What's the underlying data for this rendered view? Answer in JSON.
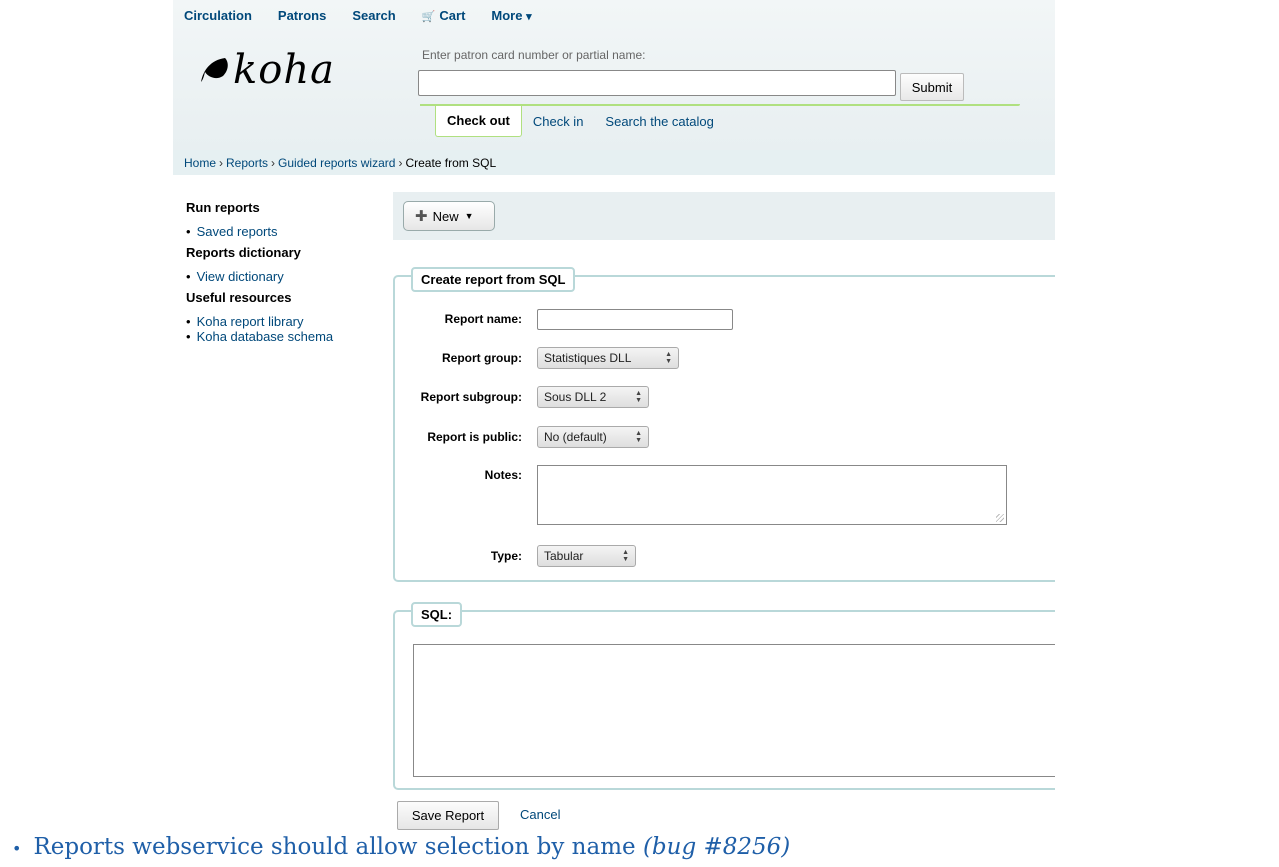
{
  "topnav": {
    "items": [
      "Circulation",
      "Patrons",
      "Search",
      "Cart",
      "More"
    ],
    "cart_icon": "cart-icon",
    "more_caret": "▾"
  },
  "logo": {
    "text": "koha"
  },
  "search": {
    "label": "Enter patron card number or partial name:",
    "value": "",
    "submit": "Submit"
  },
  "tabs": {
    "active": "Check out",
    "items": [
      "Check in",
      "Search the catalog"
    ]
  },
  "breadcrumb": [
    "Home",
    "Reports",
    "Guided reports wizard",
    "Create from SQL"
  ],
  "sidebar": {
    "sections": [
      {
        "title": "Run reports",
        "links": [
          "Saved reports"
        ]
      },
      {
        "title": "Reports dictionary",
        "links": [
          "View dictionary"
        ]
      },
      {
        "title": "Useful resources",
        "links": [
          "Koha report library",
          "Koha database schema"
        ]
      }
    ]
  },
  "toolbar": {
    "new_label": "New"
  },
  "form": {
    "legend": "Create report from SQL",
    "report_name": {
      "label": "Report name:",
      "value": ""
    },
    "report_group": {
      "label": "Report group:",
      "value": "Statistiques DLL"
    },
    "report_subgroup": {
      "label": "Report subgroup:",
      "value": "Sous DLL 2"
    },
    "report_public": {
      "label": "Report is public:",
      "value": "No (default)"
    },
    "notes": {
      "label": "Notes:",
      "value": ""
    },
    "type": {
      "label": "Type:",
      "value": "Tabular"
    }
  },
  "sql": {
    "legend": "SQL:",
    "value": ""
  },
  "actions": {
    "save": "Save Report",
    "cancel": "Cancel"
  },
  "note": {
    "text": "Reports webservice should allow selection by name",
    "bug": "(bug #8256)"
  },
  "colors": {
    "link": "#00487a",
    "fieldset_border": "#b9d8d9",
    "header_bg": "#e8eff1",
    "tab_accent": "#b0e080"
  }
}
